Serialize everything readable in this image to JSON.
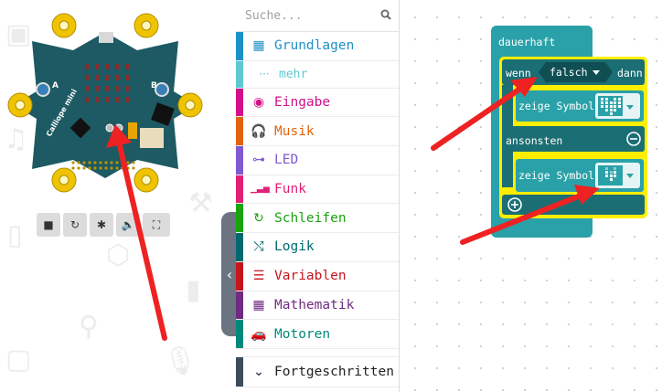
{
  "simulator": {
    "board_label": "Calliope mini",
    "pin_labels": [
      "A",
      "B"
    ],
    "controls": [
      {
        "name": "stop",
        "glyph": "■"
      },
      {
        "name": "restart",
        "glyph": "↻"
      },
      {
        "name": "debug",
        "glyph": "✱"
      },
      {
        "name": "mute",
        "glyph": "🔈"
      },
      {
        "name": "fullscreen",
        "glyph": "⛶"
      }
    ]
  },
  "toolbox": {
    "search_placeholder": "Suche...",
    "categories": [
      {
        "label": "Grundlagen",
        "color": "#1e90c8",
        "icon": "grid-icon",
        "glyph": "▦"
      },
      {
        "label": "mehr",
        "color": "#5fc9d0",
        "icon": "more-icon",
        "glyph": "···"
      },
      {
        "label": "Eingabe",
        "color": "#d1108a",
        "icon": "target-icon",
        "glyph": "◉"
      },
      {
        "label": "Musik",
        "color": "#e0630e",
        "icon": "headphones-icon",
        "glyph": "🎧"
      },
      {
        "label": "LED",
        "color": "#7f5ad1",
        "icon": "toggle-icon",
        "glyph": "⊶"
      },
      {
        "label": "Funk",
        "color": "#e31e77",
        "icon": "signal-icon",
        "glyph": "▁▃▅"
      },
      {
        "label": "Schleifen",
        "color": "#19a30e",
        "icon": "loop-icon",
        "glyph": "↻"
      },
      {
        "label": "Logik",
        "color": "#006970",
        "icon": "shuffle-icon",
        "glyph": "⤭"
      },
      {
        "label": "Variablen",
        "color": "#c4161c",
        "icon": "lines-icon",
        "glyph": "☰"
      },
      {
        "label": "Mathematik",
        "color": "#6f2b80",
        "icon": "calculator-icon",
        "glyph": "▦"
      },
      {
        "label": "Motoren",
        "color": "#00897a",
        "icon": "car-icon",
        "glyph": "🚗"
      }
    ],
    "advanced": {
      "label": "Fortgeschritten",
      "color": "#3d4b5c",
      "glyph": "⌄"
    }
  },
  "workspace": {
    "forever_label": "dauerhaft",
    "if_label": "wenn",
    "condition_value": "falsch",
    "then_label": "dann",
    "show_icon_label_1": "zeige Symbol",
    "else_label": "ansonsten",
    "show_icon_label_2": "zeige Symbol"
  },
  "colors": {
    "teal_block": "#1b6e74",
    "teal_light": "#2aa1a8",
    "highlight": "#ffee00",
    "arrow": "#ee2222",
    "board": "#1d5a63",
    "board_pad": "#f0c300"
  }
}
